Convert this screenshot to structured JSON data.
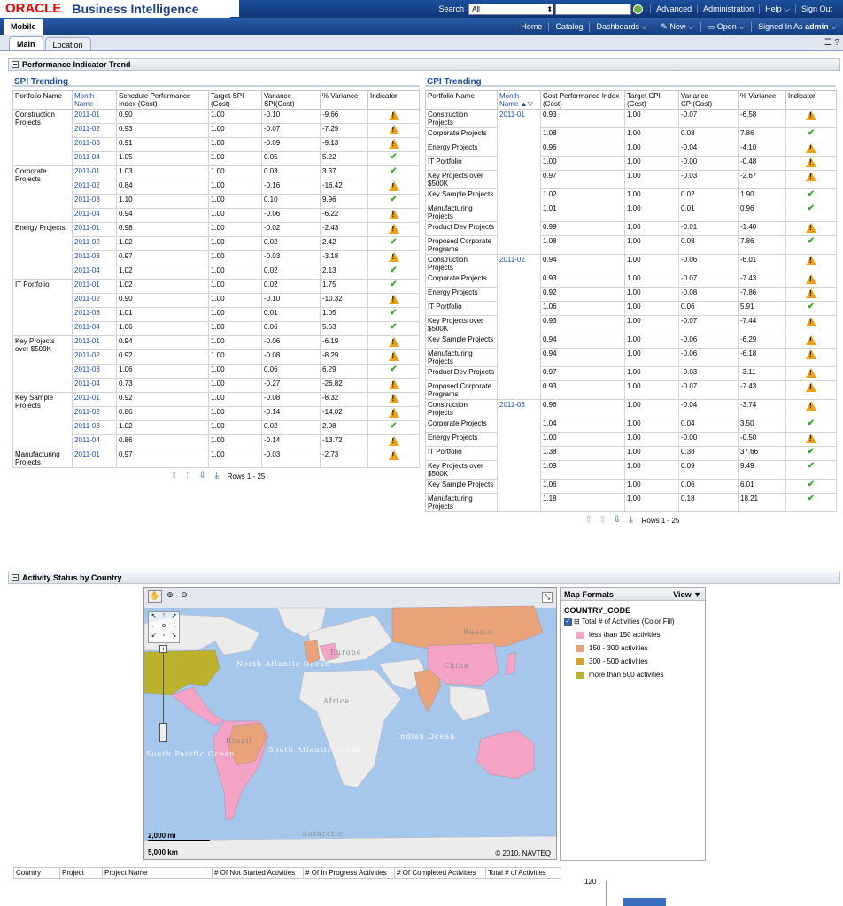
{
  "header": {
    "brand_oracle": "ORACLE",
    "brand_product": "Business Intelligence",
    "search_label": "Search",
    "search_scope": "All",
    "links": [
      "Advanced",
      "Administration",
      "Help",
      "Sign Out"
    ]
  },
  "nav": {
    "title": "Mobile",
    "links": [
      "Home",
      "Catalog",
      "Dashboards",
      "New",
      "Open"
    ],
    "signed_in_label": "Signed In As",
    "user": "admin"
  },
  "tabs": [
    "Main",
    "Location"
  ],
  "section1": {
    "title": "Performance Indicator Trend"
  },
  "spi": {
    "title": "SPI Trending",
    "headers": [
      "Portfolio Name",
      "Month Name",
      "Schedule Performance Index (Cost)",
      "Target SPI (Cost)",
      "Variance SPI(Cost)",
      "% Variance",
      "Indicator"
    ],
    "groups": [
      {
        "name": "Construction Projects",
        "rows": [
          [
            "2011-01",
            "0.90",
            "1.00",
            "-0.10",
            "-9.66",
            "w"
          ],
          [
            "2011-02",
            "0.93",
            "1.00",
            "-0.07",
            "-7.29",
            "w"
          ],
          [
            "2011-03",
            "0.91",
            "1.00",
            "-0.09",
            "-9.13",
            "w"
          ],
          [
            "2011-04",
            "1.05",
            "1.00",
            "0.05",
            "5.22",
            "o"
          ]
        ]
      },
      {
        "name": "Corporate Projects",
        "rows": [
          [
            "2011-01",
            "1.03",
            "1.00",
            "0.03",
            "3.37",
            "o"
          ],
          [
            "2011-02",
            "0.84",
            "1.00",
            "-0.16",
            "-16.42",
            "w"
          ],
          [
            "2011-03",
            "1.10",
            "1.00",
            "0.10",
            "9.96",
            "o"
          ],
          [
            "2011-04",
            "0.94",
            "1.00",
            "-0.06",
            "-6.22",
            "w"
          ]
        ]
      },
      {
        "name": "Energy Projects",
        "rows": [
          [
            "2011-01",
            "0.98",
            "1.00",
            "-0.02",
            "-2.43",
            "w"
          ],
          [
            "2011-02",
            "1.02",
            "1.00",
            "0.02",
            "2.42",
            "o"
          ],
          [
            "2011-03",
            "0.97",
            "1.00",
            "-0.03",
            "-3.18",
            "w"
          ],
          [
            "2011-04",
            "1.02",
            "1.00",
            "0.02",
            "2.13",
            "o"
          ]
        ]
      },
      {
        "name": "IT Portfolio",
        "rows": [
          [
            "2011-01",
            "1.02",
            "1.00",
            "0.02",
            "1.75",
            "o"
          ],
          [
            "2011-02",
            "0.90",
            "1.00",
            "-0.10",
            "-10.32",
            "w"
          ],
          [
            "2011-03",
            "1.01",
            "1.00",
            "0.01",
            "1.05",
            "o"
          ],
          [
            "2011-04",
            "1.06",
            "1.00",
            "0.06",
            "5.63",
            "o"
          ]
        ]
      },
      {
        "name": "Key Projects over $500K",
        "rows": [
          [
            "2011-01",
            "0.94",
            "1.00",
            "-0.06",
            "-6.19",
            "w"
          ],
          [
            "2011-02",
            "0.92",
            "1.00",
            "-0.08",
            "-8.29",
            "w"
          ],
          [
            "2011-03",
            "1.06",
            "1.00",
            "0.06",
            "6.29",
            "o"
          ],
          [
            "2011-04",
            "0.73",
            "1.00",
            "-0.27",
            "-26.82",
            "w"
          ]
        ]
      },
      {
        "name": "Key Sample Projects",
        "rows": [
          [
            "2011-01",
            "0.92",
            "1.00",
            "-0.08",
            "-8.32",
            "w"
          ],
          [
            "2011-02",
            "0.86",
            "1.00",
            "-0.14",
            "-14.02",
            "w"
          ],
          [
            "2011-03",
            "1.02",
            "1.00",
            "0.02",
            "2.08",
            "o"
          ],
          [
            "2011-04",
            "0.86",
            "1.00",
            "-0.14",
            "-13.72",
            "w"
          ]
        ]
      },
      {
        "name": "Manufacturing Projects",
        "rows": [
          [
            "2011-01",
            "0.97",
            "1.00",
            "-0.03",
            "-2.73",
            "w"
          ]
        ]
      }
    ],
    "rows_label": "Rows 1 - 25"
  },
  "cpi": {
    "title": "CPI Trending",
    "headers": [
      "Portfolio Name",
      "Month Name",
      "Cost Performance Index (Cost)",
      "Target CPI (Cost)",
      "Variance CPI(Cost)",
      "% Variance",
      "Indicator"
    ],
    "groups": [
      {
        "month": "2011-01",
        "rows": [
          [
            "Construction Projects",
            "0.93",
            "1.00",
            "-0.07",
            "-6.58",
            "w"
          ],
          [
            "Corporate Projects",
            "1.08",
            "1.00",
            "0.08",
            "7.86",
            "o"
          ],
          [
            "Energy Projects",
            "0.96",
            "1.00",
            "-0.04",
            "-4.10",
            "w"
          ],
          [
            "IT Portfolio",
            "1.00",
            "1.00",
            "-0.00",
            "-0.48",
            "w"
          ],
          [
            "Key Projects over $500K",
            "0.97",
            "1.00",
            "-0.03",
            "-2.67",
            "w"
          ],
          [
            "Key Sample Projects",
            "1.02",
            "1.00",
            "0.02",
            "1.90",
            "o"
          ],
          [
            "Manufacturing Projects",
            "1.01",
            "1.00",
            "0.01",
            "0.96",
            "o"
          ],
          [
            "Product Dev Projects",
            "0.99",
            "1.00",
            "-0.01",
            "-1.40",
            "w"
          ],
          [
            "Proposed Corporate Programs",
            "1.08",
            "1.00",
            "0.08",
            "7.86",
            "o"
          ]
        ]
      },
      {
        "month": "2011-02",
        "rows": [
          [
            "Construction Projects",
            "0.94",
            "1.00",
            "-0.06",
            "-6.01",
            "w"
          ],
          [
            "Corporate Projects",
            "0.93",
            "1.00",
            "-0.07",
            "-7.43",
            "w"
          ],
          [
            "Energy Projects",
            "0.92",
            "1.00",
            "-0.08",
            "-7.86",
            "w"
          ],
          [
            "IT Portfolio",
            "1.06",
            "1.00",
            "0.06",
            "5.91",
            "o"
          ],
          [
            "Key Projects over $500K",
            "0.93",
            "1.00",
            "-0.07",
            "-7.44",
            "w"
          ],
          [
            "Key Sample Projects",
            "0.94",
            "1.00",
            "-0.06",
            "-6.29",
            "w"
          ],
          [
            "Manufacturing Projects",
            "0.94",
            "1.00",
            "-0.06",
            "-6.18",
            "w"
          ],
          [
            "Product Dev Projects",
            "0.97",
            "1.00",
            "-0.03",
            "-3.11",
            "w"
          ],
          [
            "Proposed Corporate Programs",
            "0.93",
            "1.00",
            "-0.07",
            "-7.43",
            "w"
          ]
        ]
      },
      {
        "month": "2011-03",
        "rows": [
          [
            "Construction Projects",
            "0.96",
            "1.00",
            "-0.04",
            "-3.74",
            "w"
          ],
          [
            "Corporate Projects",
            "1.04",
            "1.00",
            "0.04",
            "3.50",
            "o"
          ],
          [
            "Energy Projects",
            "1.00",
            "1.00",
            "-0.00",
            "-0.50",
            "w"
          ],
          [
            "IT Portfolio",
            "1.38",
            "1.00",
            "0.38",
            "37.66",
            "o"
          ],
          [
            "Key Projects over $500K",
            "1.09",
            "1.00",
            "0.09",
            "9.49",
            "o"
          ],
          [
            "Key Sample Projects",
            "1.06",
            "1.00",
            "0.06",
            "6.01",
            "o"
          ],
          [
            "Manufacturing Projects",
            "1.18",
            "1.00",
            "0.18",
            "18.21",
            "o"
          ]
        ]
      }
    ],
    "rows_label": "Rows 1 - 25"
  },
  "section2": {
    "title": "Activity Status by Country"
  },
  "map": {
    "labels": [
      "North Atlantic Ocean",
      "South Pacific Ocean",
      "South Atlantic Ocean",
      "Indian Ocean",
      "Africa",
      "Europe",
      "Russia",
      "China",
      "Brazil",
      "Antarctic"
    ],
    "scale_mi": "2,000 mi",
    "scale_km": "5,000 km",
    "copyright": "© 2010, NAVTEQ"
  },
  "legend": {
    "title": "Map Formats",
    "view": "View",
    "country_code": "COUNTRY_CODE",
    "measure": "Total # of Activities (Color Fill)",
    "items": [
      {
        "label": "less than 150 activities",
        "color": "#f4a2c6"
      },
      {
        "label": "150 - 300 activities",
        "color": "#e9a27a"
      },
      {
        "label": "300 - 500 activities",
        "color": "#d9a321"
      },
      {
        "label": "more than 500 activities",
        "color": "#bcb12b"
      }
    ]
  },
  "bottom": {
    "headers": [
      "Country",
      "Project",
      "Project Name",
      "# Of Not Started Activities",
      "# Of In Progress Activities",
      "# Of Completed Activities",
      "Total # of Activities"
    ],
    "chart_tick": "120"
  }
}
